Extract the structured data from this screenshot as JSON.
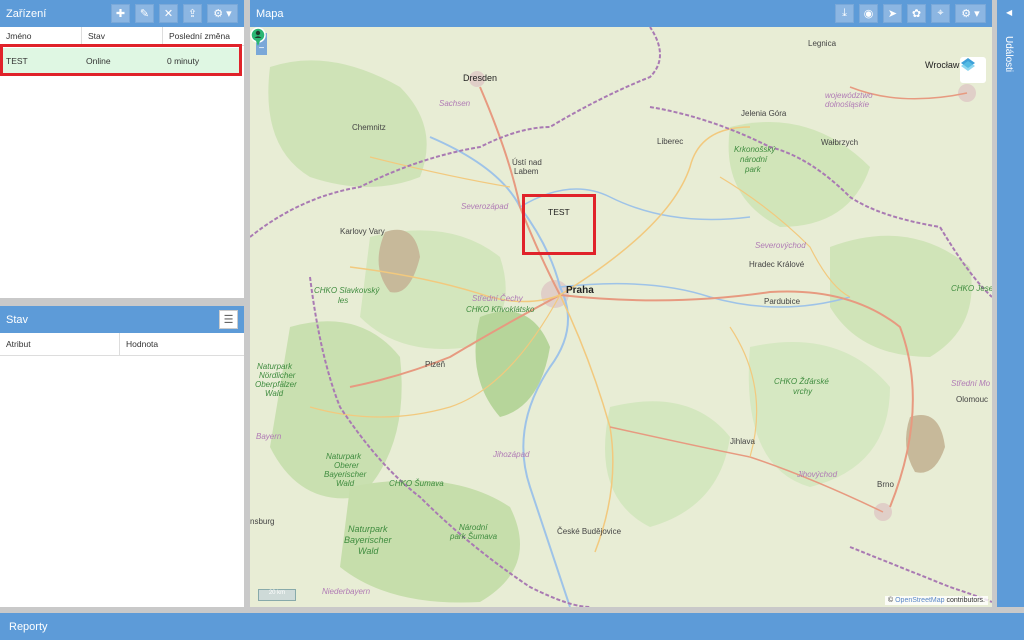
{
  "devices_panel": {
    "title": "Zařízení",
    "toolbar": {
      "add_icon": "plus-icon",
      "edit_icon": "pencil-icon",
      "delete_icon": "close-icon",
      "upload_icon": "upload-icon",
      "settings_icon": "gear-icon"
    },
    "columns": [
      "Jméno",
      "Stav",
      "Poslední změna"
    ],
    "rows": [
      {
        "name": "TEST",
        "status": "Online",
        "last_change": "0 minuty"
      }
    ],
    "selected_row_color": "#dff7e3"
  },
  "status_panel": {
    "title": "Stav",
    "columns": [
      "Atribut",
      "Hodnota"
    ]
  },
  "map_panel": {
    "title": "Mapa",
    "toolbar_icons": [
      "download-icon",
      "record-icon",
      "navigate-icon",
      "paw-icon",
      "crosshair-icon",
      "gear-icon"
    ],
    "zoom_in": "+",
    "zoom_out": "−",
    "marker_label": "TEST",
    "attribution_prefix": "© ",
    "attribution_link": "OpenStreetMap",
    "attribution_suffix": " contributors.",
    "labels": {
      "dresden": "Dresden",
      "legnica": "Legnica",
      "wroclaw": "Wrocław",
      "sachsen": "Sachsen",
      "chemnitz": "Chemnitz",
      "woj1": "województwo",
      "woj2": "dolnośląskie",
      "jelenia": "Jelenia Góra",
      "walbrzych": "Wałbrzych",
      "usti1": "Ústí nad",
      "usti2": "Labem",
      "liberec": "Liberec",
      "krk1": "Krkonošský",
      "krk2": "národní",
      "krk3": "park",
      "severozapad": "Severozápad",
      "severovychod": "Severovýchod",
      "karlovy": "Karlovy Vary",
      "hradec": "Hradec Králové",
      "chko_slav1": "CHKO Slavkovský",
      "chko_slav2": "les",
      "stredni": "Střední Čechy",
      "chko_kriv": "CHKO Křivoklátsko",
      "praha": "Praha",
      "pardubice": "Pardubice",
      "chko_jes": "CHKO Jesen",
      "np1": "Naturpark",
      "np2": "Nördlicher",
      "np3": "Oberpfälzer",
      "np4": "Wald",
      "plzen": "Plzeň",
      "chko_zdar1": "CHKO Žďárské",
      "chko_zdar2": "vrchy",
      "stredni_mo": "Střední Mo",
      "olomouc": "Olomouc",
      "bayern": "Bayern",
      "jihlava": "Jihlava",
      "jihozapad": "Jihozápad",
      "jihovychod": "Jihovýchod",
      "no1": "Naturpark",
      "no2": "Oberer",
      "no3": "Bayerischer",
      "no4": "Wald",
      "chko_sum": "CHKO Šumava",
      "brno": "Brno",
      "nsburg": "nsburg",
      "nbw1": "Naturpark",
      "nbw2": "Bayerischer",
      "nbw3": "Wald",
      "nps1": "Národní",
      "nps2": "park Šumava",
      "ceske": "České Budějovice",
      "niederbayern": "Niederbayern",
      "scale": "20 km"
    }
  },
  "events_panel": {
    "title": "Události"
  },
  "reports_panel": {
    "title": "Reporty"
  },
  "colors": {
    "header_blue": "#5d9bd8",
    "highlight_red": "#e0222a",
    "marker_green": "#2bb673"
  }
}
